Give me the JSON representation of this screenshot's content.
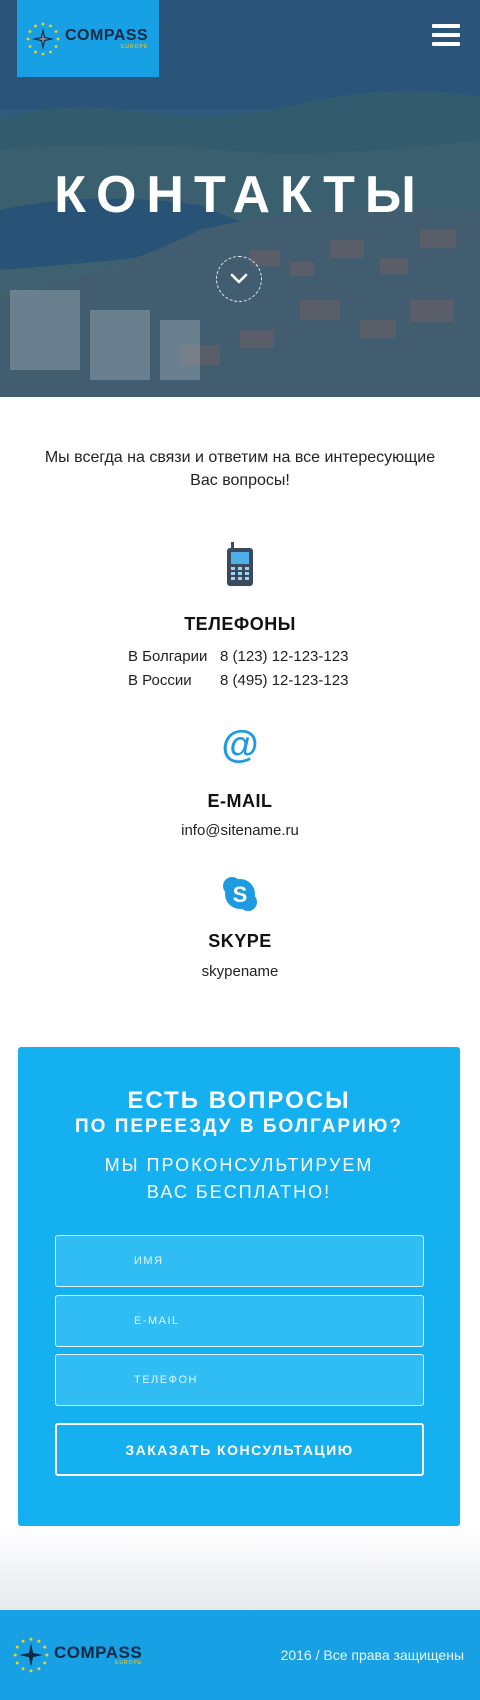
{
  "header": {
    "logo_name": "COMPASS",
    "logo_sub": "EUROPE",
    "menu_icon": "hamburger-icon"
  },
  "hero": {
    "title": "КОНТАКТЫ",
    "scroll_icon": "chevron-down-icon"
  },
  "intro": {
    "text": "Мы всегда на связи и ответим на все интересующие Вас вопросы!"
  },
  "phones": {
    "icon": "mobile-phone-icon",
    "title": "ТЕЛЕФОНЫ",
    "rows": [
      {
        "country": "В Болгарии",
        "number": "8 (123) 12-123-123"
      },
      {
        "country": "В России",
        "number": "8 (495) 12-123-123"
      }
    ]
  },
  "email": {
    "icon": "at-sign-icon",
    "title": "E-MAIL",
    "value": "info@sitename.ru"
  },
  "skype": {
    "icon": "skype-icon",
    "title": "SKYPE",
    "value": "skypename"
  },
  "form": {
    "heading_1": "ЕСТЬ ВОПРОСЫ",
    "heading_2": "ПО ПЕРЕЕЗДУ В БОЛГАРИЮ?",
    "subheading_1": "МЫ ПРОКОНСУЛЬТИРУЕМ",
    "subheading_2": "ВАС БЕСПЛАТНО!",
    "name_placeholder": "ИМЯ",
    "email_placeholder": "E-MAIL",
    "phone_placeholder": "ТЕЛЕФОН",
    "submit_label": "ЗАКАЗАТЬ КОНСУЛЬТАЦИЮ"
  },
  "footer": {
    "logo_name": "COMPASS",
    "logo_sub": "EUROPE",
    "copyright": "2016 / Все права защищены"
  },
  "colors": {
    "brand_blue": "#18a0e4",
    "form_blue": "#14b0f0",
    "logo_navy": "#0d2a44",
    "star_yellow": "#f5d020",
    "icon_blue": "#1e9ae0"
  }
}
